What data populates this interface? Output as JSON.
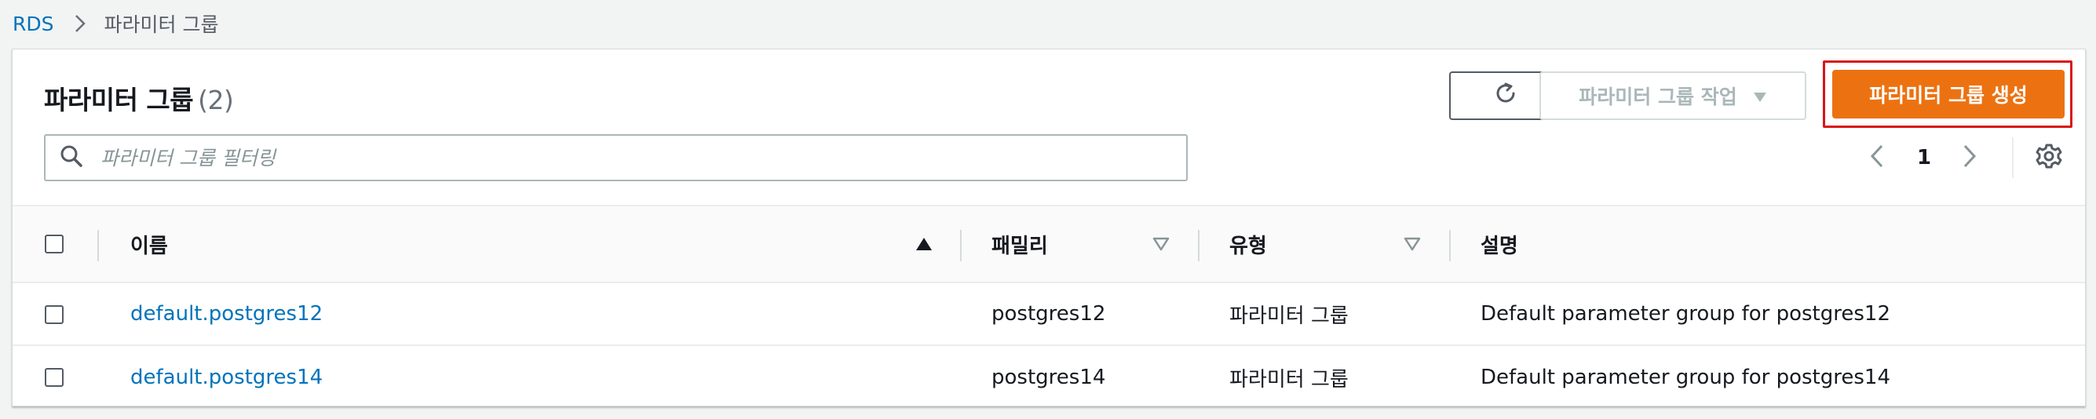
{
  "breadcrumb": {
    "root": "RDS",
    "current": "파라미터 그룹"
  },
  "panel": {
    "title": "파라미터 그룹",
    "count": "(2)"
  },
  "toolbar": {
    "refresh_icon": "refresh-icon",
    "actions_label": "파라미터 그룹 작업",
    "create_label": "파라미터 그룹 생성"
  },
  "search": {
    "placeholder": "파라미터 그룹 필터링",
    "value": ""
  },
  "pagination": {
    "current_page": "1"
  },
  "table": {
    "columns": [
      {
        "label": "이름",
        "sort": "ascending"
      },
      {
        "label": "패밀리",
        "sort": "none"
      },
      {
        "label": "유형",
        "sort": "none"
      },
      {
        "label": "설명",
        "sort": "none"
      }
    ],
    "rows": [
      {
        "name": "default.postgres12",
        "family": "postgres12",
        "type": "파라미터 그룹",
        "description": "Default parameter group for postgres12"
      },
      {
        "name": "default.postgres14",
        "family": "postgres14",
        "type": "파라미터 그룹",
        "description": "Default parameter group for postgres14"
      }
    ]
  },
  "colors": {
    "link": "#0073bb",
    "primary": "#ec7211",
    "highlight_outline": "#d91515",
    "disabled_text": "#aab7b8"
  }
}
